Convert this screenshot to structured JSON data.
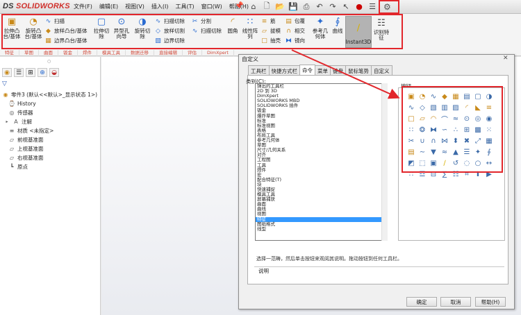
{
  "app": {
    "logo_ds": "DS",
    "logo_name": "SOLIDWORKS"
  },
  "menu": [
    "文件(F)",
    "编辑(E)",
    "视图(V)",
    "插入(I)",
    "工具(T)",
    "窗口(W)",
    "帮助(H)"
  ],
  "ribbon": {
    "extrude_boss": "拉伸凸台/基体",
    "revolve_boss": "旋转凸台/基体",
    "sweep": "扫描",
    "loft_boss": "放样凸台/基体",
    "boundary_boss": "边界凸台/基体",
    "extrude_cut": "拉伸切除",
    "hole_wizard": "异型孔向导",
    "revolve_cut": "旋转切除",
    "swept_cut": "扫描切除",
    "lofted_cut": "放样切割",
    "boundary_cut": "边界切除",
    "split": "分割",
    "swept_cut2": "扫描切除",
    "fillet": "圆角",
    "linear_pattern": "线性阵列",
    "rib": "筋",
    "draft": "拔模",
    "shell": "抽壳",
    "wrap": "包覆",
    "intersect": "相交",
    "mirror": "镜向",
    "ref_geometry": "参考几何体",
    "curves": "曲线",
    "instant3d": "Instant3D",
    "recognize": "识别特征"
  },
  "cm_tabs": [
    "特征",
    "草图",
    "曲面",
    "钣金",
    "焊件",
    "模具工具",
    "数据迁移",
    "直接编辑",
    "评估",
    "DimXpert"
  ],
  "feature_tree": {
    "part": "零件3 (默认<<默认>_显示状态 1>)",
    "items": [
      "History",
      "传感器",
      "注解",
      "材质 <未指定>",
      "前视基准面",
      "上视基准面",
      "右视基准面",
      "原点"
    ]
  },
  "dialog": {
    "title": "自定义",
    "tabs": [
      "工具栏",
      "快捷方式栏",
      "命令",
      "菜单",
      "键盘",
      "鼠标笔势",
      "自定义"
    ],
    "category_label": "类别(C):",
    "buttons_label": "按钮",
    "categories": [
      "弹出的工具栏",
      "2D 到 3D",
      "DimXpert",
      "SOLIDWORKS MBD",
      "SOLIDWORKS 插件",
      "钣金",
      "爆炸草图",
      "标准",
      "标准视图",
      "表格",
      "布局工具",
      "参考几何体",
      "草图",
      "尺寸/几何关系",
      "对齐",
      "工程图",
      "工具",
      "焊件",
      "宏",
      "配合特征(T)",
      "块",
      "快速捕捉",
      "模具工具",
      "屏幕捕获",
      "曲面",
      "曲线",
      "视图",
      "特征",
      "图纸格式",
      "线型"
    ],
    "selected_category": "特征",
    "description": "选择一范畴，然后单击按钮来观阅其说明。拖动按钮到任何工具栏。",
    "explain_label": "说明",
    "ok": "确定",
    "cancel": "取消",
    "help": "帮助(H)"
  },
  "colors": {
    "highlight": "#e2262b",
    "selection": "#3399ff",
    "brand": "#d0302b"
  }
}
